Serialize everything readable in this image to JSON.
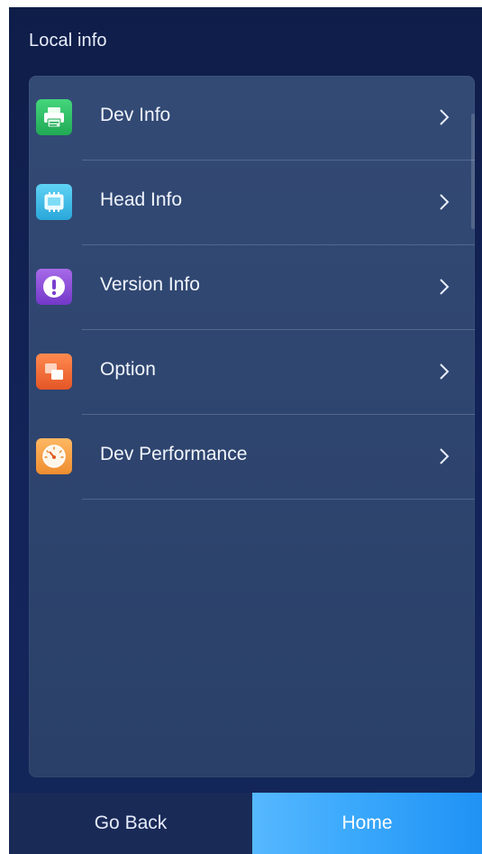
{
  "header": {
    "title": "Local info"
  },
  "menu": {
    "items": [
      {
        "label": "Dev Info",
        "icon": "printer-icon",
        "color": "#35c06a"
      },
      {
        "label": "Head Info",
        "icon": "print-head-icon",
        "color": "#35b9e6"
      },
      {
        "label": "Version Info",
        "icon": "exclamation-icon",
        "color": "#8a4bd8"
      },
      {
        "label": "Option",
        "icon": "layers-icon",
        "color": "#f36a39"
      },
      {
        "label": "Dev Performance",
        "icon": "gauge-icon",
        "color": "#f2a145"
      }
    ]
  },
  "bottom_bar": {
    "back_label": "Go Back",
    "home_label": "Home"
  },
  "colors": {
    "background": "#13245a",
    "panel": "#2f4670",
    "home_accent": "#3aa8fb"
  }
}
